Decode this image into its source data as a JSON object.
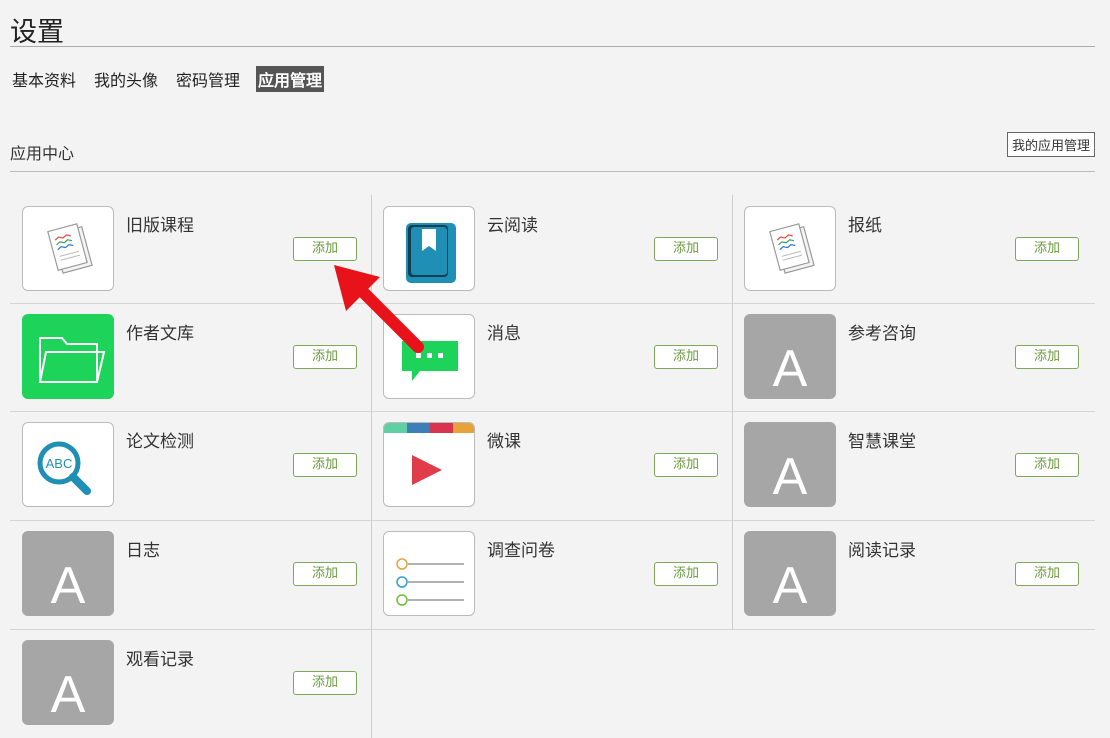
{
  "page": {
    "title": "设置"
  },
  "subnav": {
    "items": [
      "基本资料",
      "我的头像",
      "密码管理",
      "应用管理"
    ],
    "active": "应用管理"
  },
  "app_center": {
    "title": "应用中心",
    "manage_button": "我的应用管理",
    "add_label": "添加",
    "apps": [
      {
        "name": "旧版课程",
        "icon": "newspaper-icon"
      },
      {
        "name": "云阅读",
        "icon": "book-icon"
      },
      {
        "name": "报纸",
        "icon": "newspaper-icon"
      },
      {
        "name": "作者文库",
        "icon": "folder-icon"
      },
      {
        "name": "消息",
        "icon": "chat-bubble-icon"
      },
      {
        "name": "参考咨询",
        "icon": "letter-a-icon"
      },
      {
        "name": "论文检测",
        "icon": "abc-magnifier-icon"
      },
      {
        "name": "微课",
        "icon": "play-icon"
      },
      {
        "name": "智慧课堂",
        "icon": "letter-a-icon"
      },
      {
        "name": "日志",
        "icon": "letter-a-icon"
      },
      {
        "name": "调查问卷",
        "icon": "survey-list-icon"
      },
      {
        "name": "阅读记录",
        "icon": "letter-a-icon"
      },
      {
        "name": "观看记录",
        "icon": "letter-a-icon"
      }
    ],
    "icon_letter": "A"
  },
  "colors": {
    "active_tab_bg": "#555555",
    "add_button_border": "#7ea75a",
    "add_button_text": "#6a9b3e",
    "folder_green": "#1dd35a",
    "book_blue": "#1f8fb5",
    "play_red": "#e03c4a",
    "placeholder_gray": "#a6a6a6",
    "annotation_arrow": "#e8121b"
  }
}
